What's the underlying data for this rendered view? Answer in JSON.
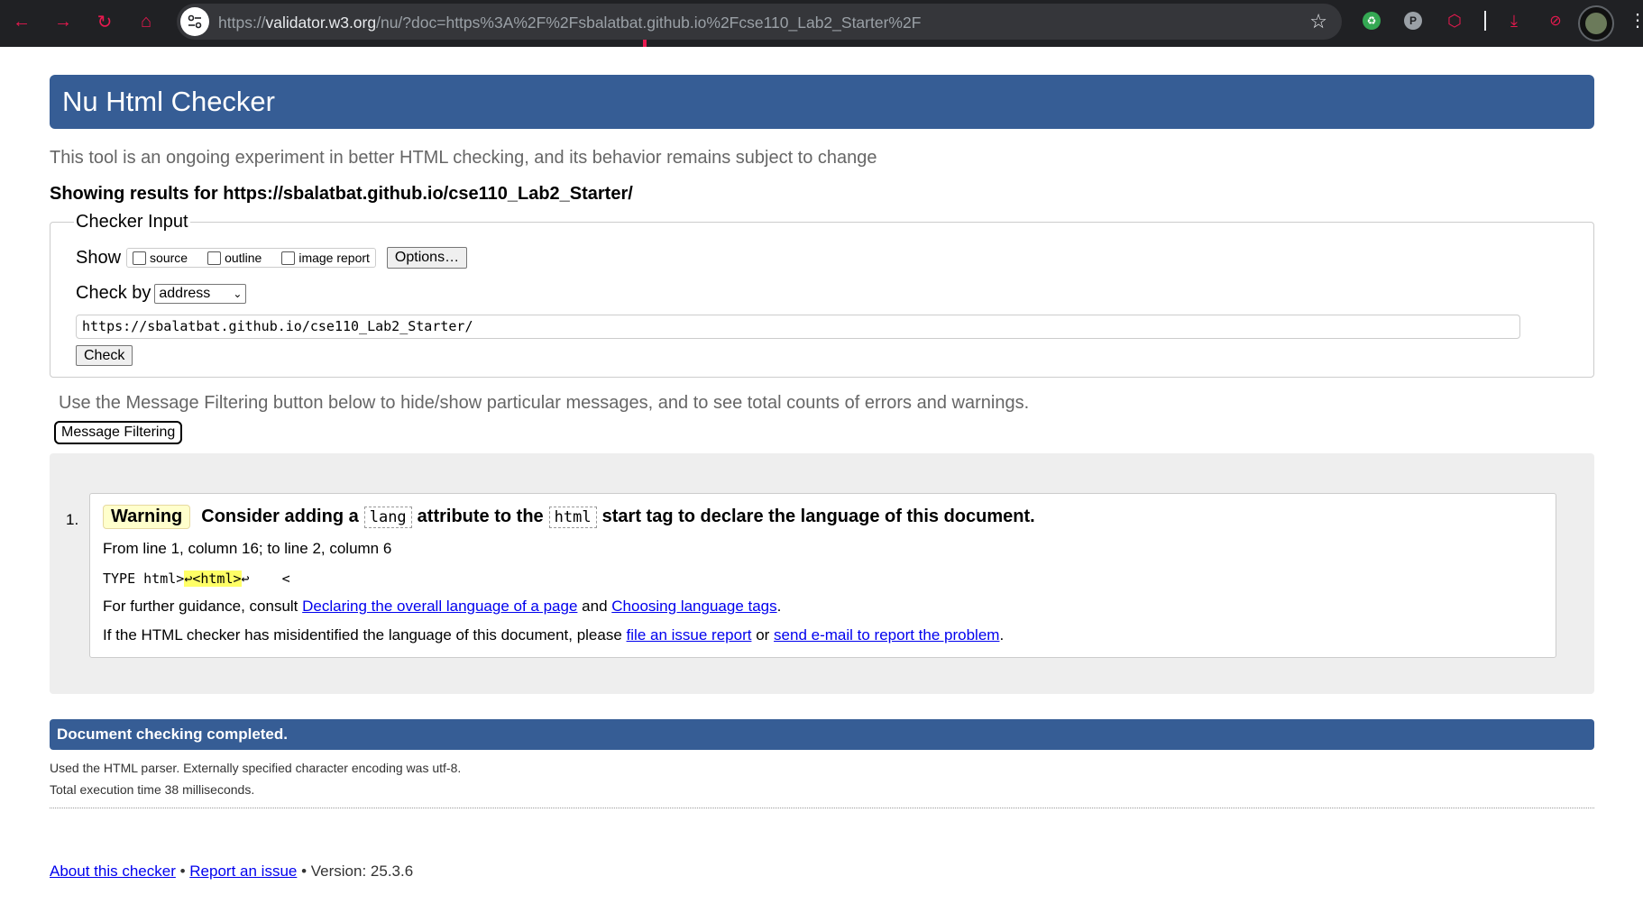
{
  "browser": {
    "url_prefix": "https://",
    "url_host": "validator.w3.org",
    "url_rest": "/nu/?doc=https%3A%2F%2Fsbalatbat.github.io%2Fcse110_Lab2_Starter%2F",
    "accent_color": "#e8194f",
    "extensions": [
      "green-extension-icon",
      "p-extension-icon",
      "red-puzzle-icon",
      "download-icon",
      "eye-off-icon"
    ]
  },
  "header": {
    "title": "Nu Html Checker"
  },
  "intro": "This tool is an ongoing experiment in better HTML checking, and its behavior remains subject to change",
  "showing": "Showing results for https://sbalatbat.github.io/cse110_Lab2_Starter/",
  "checker_input": {
    "legend": "Checker Input",
    "show_label": "Show",
    "options": [
      "source",
      "outline",
      "image report"
    ],
    "options_button": "Options…",
    "check_by_label": "Check by",
    "check_by_value": "address",
    "url_value": "https://sbalatbat.github.io/cse110_Lab2_Starter/",
    "check_button": "Check"
  },
  "filter": {
    "note": "Use the Message Filtering button below to hide/show particular messages, and to see total counts of errors and warnings.",
    "button": "Message Filtering"
  },
  "messages": [
    {
      "number": "1.",
      "type": "Warning",
      "title_part1": "Consider adding a",
      "code1": "lang",
      "title_part2": "attribute to the",
      "code2": "html",
      "title_part3": "start tag to declare the language of this document.",
      "location": "From line 1, column 16; to line 2, column 6",
      "extract_before": "TYPE html>",
      "extract_highlight": "↩<html>",
      "extract_after": "↩    <",
      "guide_prefix": "For further guidance, consult",
      "guide_link1": "Declaring the overall language of a page",
      "guide_and": "and",
      "guide_link2": "Choosing language tags",
      "guide_end": ".",
      "report_prefix": "If the HTML checker has misidentified the language of this document, please",
      "report_link1": "file an issue report",
      "report_or": "or",
      "report_link2": "send e-mail to report the problem",
      "report_end": "."
    }
  ],
  "completion": {
    "title": "Document checking completed.",
    "parser": "Used the HTML parser. Externally specified character encoding was utf-8.",
    "time": "Total execution time 38 milliseconds."
  },
  "footer": {
    "about": "About this checker",
    "bullet": "•",
    "report": "Report an issue",
    "version": "• Version: 25.3.6"
  }
}
